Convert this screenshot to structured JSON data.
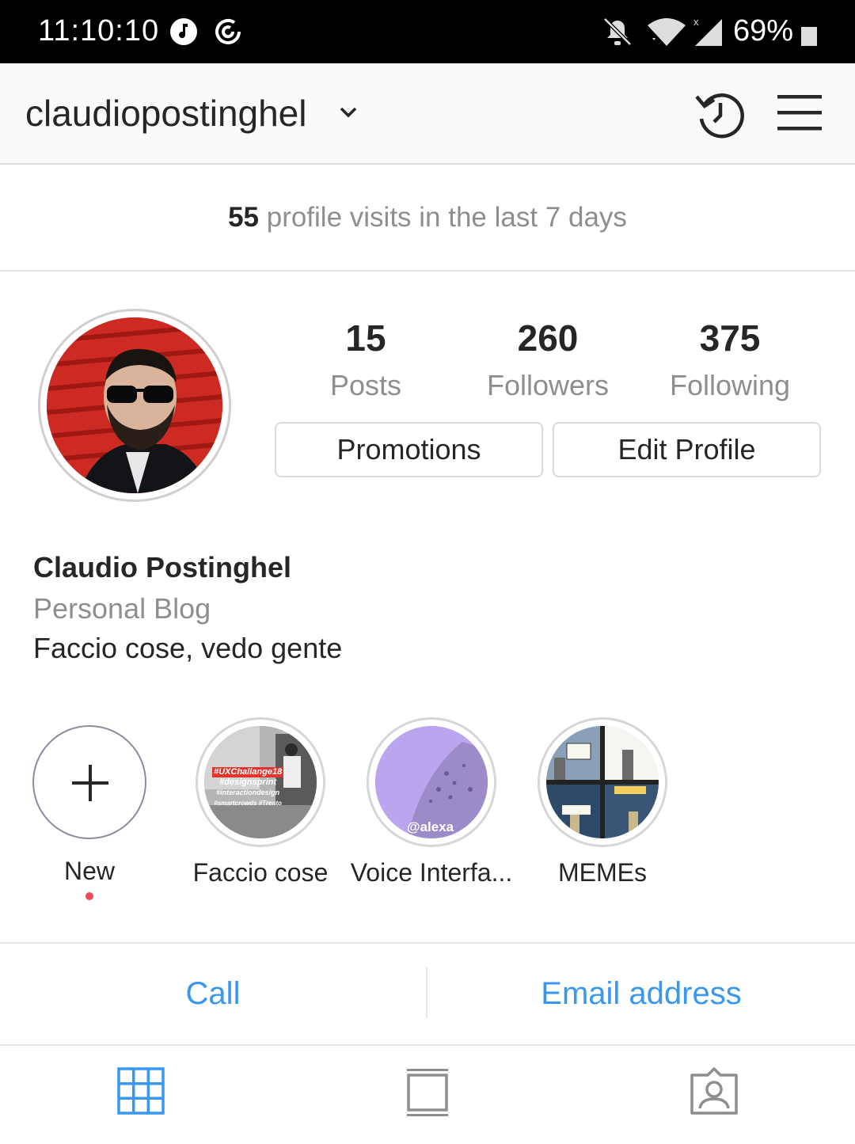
{
  "status_bar": {
    "time": "11:10:10",
    "battery": "69%",
    "icons": [
      "music-note-icon",
      "sync-icon",
      "mute-icon",
      "wifi-icon",
      "signal-icon",
      "battery-icon"
    ]
  },
  "header": {
    "username": "claudiopostinghel",
    "icons": [
      "chevron-down-icon",
      "history-icon",
      "menu-icon"
    ]
  },
  "visits": {
    "count": "55",
    "text": " profile visits in the last 7 days"
  },
  "stats": [
    {
      "value": "15",
      "label": "Posts"
    },
    {
      "value": "260",
      "label": "Followers"
    },
    {
      "value": "375",
      "label": "Following"
    }
  ],
  "buttons": {
    "promotions": "Promotions",
    "edit_profile": "Edit Profile"
  },
  "bio": {
    "name": "Claudio Postinghel",
    "category": "Personal Blog",
    "text": "Faccio cose, vedo gente"
  },
  "highlights": [
    {
      "label": "New"
    },
    {
      "label": "Faccio cose",
      "overlay": [
        "#UXChallange18",
        "#designsprint",
        "#interactiondesign",
        "#smartcrowds #Trento"
      ]
    },
    {
      "label": "Voice Interfa...",
      "overlay": [
        "@alexa"
      ]
    },
    {
      "label": "MEMEs"
    }
  ],
  "contact": {
    "call": "Call",
    "email": "Email address"
  },
  "colors": {
    "accent": "#3897f0",
    "notification_dot": "#ed4956"
  }
}
